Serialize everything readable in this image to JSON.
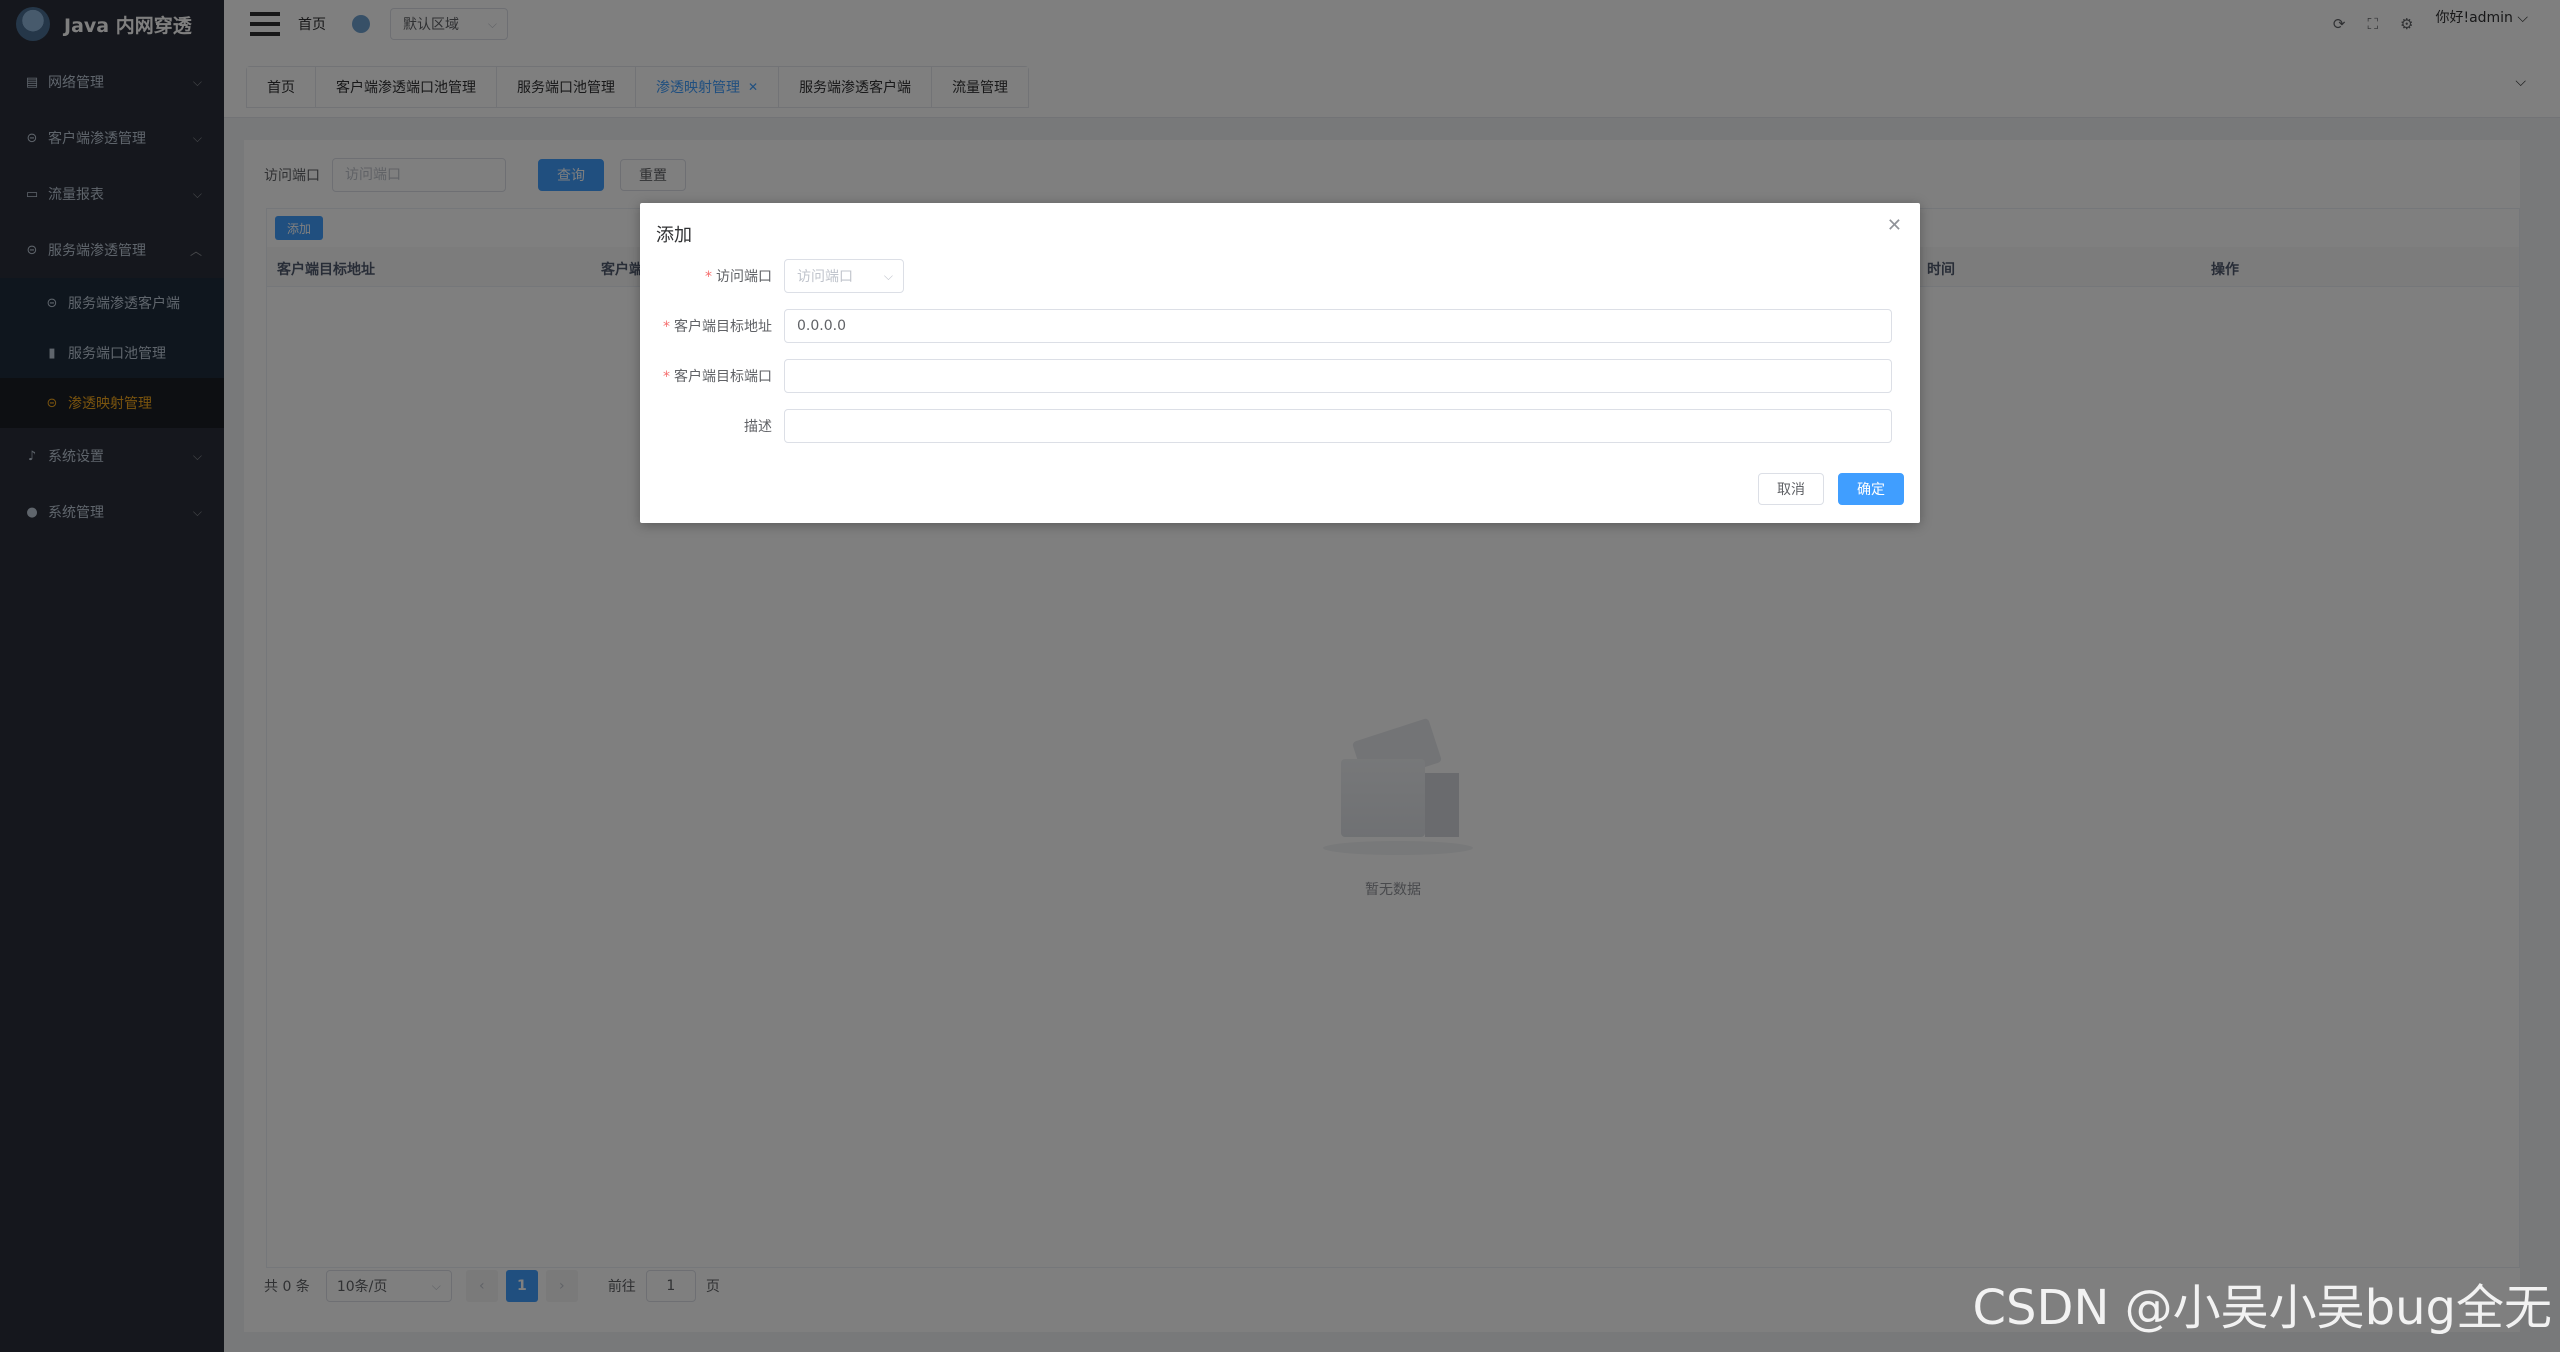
{
  "brand": {
    "title": "Java 内网穿透"
  },
  "sidebar": {
    "items": [
      {
        "label": "网络管理",
        "icon": "document-icon"
      },
      {
        "label": "客户端渗透管理",
        "icon": "link-icon"
      },
      {
        "label": "流量报表",
        "icon": "monitor-icon"
      },
      {
        "label": "服务端渗透管理",
        "icon": "link-icon"
      },
      {
        "label": "系统设置",
        "icon": "microphone-icon"
      },
      {
        "label": "系统管理",
        "icon": "user-icon"
      }
    ],
    "submenu": [
      {
        "label": "服务端渗透客户端",
        "icon": "link-icon"
      },
      {
        "label": "服务端口池管理",
        "icon": "bar-chart-icon"
      },
      {
        "label": "渗透映射管理",
        "icon": "link-icon"
      }
    ]
  },
  "topbar": {
    "home": "首页",
    "region": "默认区域",
    "user": "你好!admin"
  },
  "tags": [
    {
      "label": "首页"
    },
    {
      "label": "客户端渗透端口池管理"
    },
    {
      "label": "服务端口池管理"
    },
    {
      "label": "渗透映射管理"
    },
    {
      "label": "服务端渗透客户端"
    },
    {
      "label": "流量管理"
    }
  ],
  "search": {
    "label": "访问端口",
    "placeholder": "访问端口",
    "query_btn": "查询",
    "reset_btn": "重置"
  },
  "table": {
    "add_btn": "添加",
    "columns": [
      "客户端目标地址",
      "客户端",
      "时间",
      "操作"
    ],
    "empty_text": "暂无数据"
  },
  "pager": {
    "total": "共 0 条",
    "page_size": "10条/页",
    "current": "1",
    "goto_label": "前往",
    "goto_value": "1",
    "page_suffix": "页"
  },
  "dialog": {
    "title": "添加",
    "fields": [
      {
        "label": "访问端口",
        "required": "*",
        "placeholder": "访问端口",
        "value": ""
      },
      {
        "label": "客户端目标地址",
        "required": "*",
        "placeholder": "",
        "value": "0.0.0.0"
      },
      {
        "label": "客户端目标端口",
        "required": "*",
        "placeholder": "",
        "value": ""
      },
      {
        "label": "描述",
        "required": "",
        "placeholder": "",
        "value": ""
      }
    ],
    "cancel": "取消",
    "confirm": "确定"
  },
  "watermark": "CSDN @小吴小吴bug全无",
  "colors": {
    "primary": "#409eff",
    "sidebar_bg": "#2b2f3a",
    "active_menu": "#f4a81d",
    "required": "#f56c6c"
  }
}
